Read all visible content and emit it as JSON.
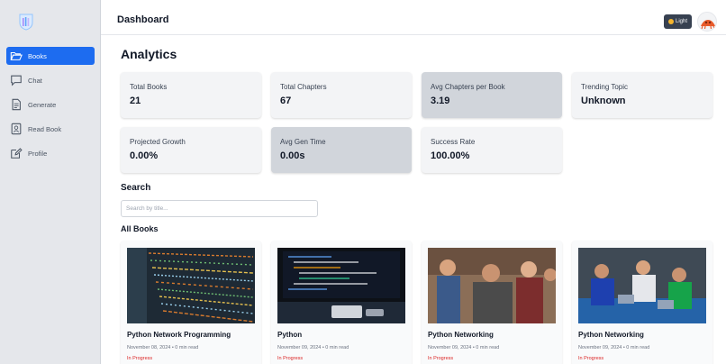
{
  "sidebar": {
    "items": [
      {
        "label": "Books",
        "icon": "folder-open-icon",
        "active": true
      },
      {
        "label": "Chat",
        "icon": "chat-icon",
        "active": false
      },
      {
        "label": "Generate",
        "icon": "document-icon",
        "active": false
      },
      {
        "label": "Read Book",
        "icon": "contact-book-icon",
        "active": false
      },
      {
        "label": "Profile",
        "icon": "edit-icon",
        "active": false
      }
    ]
  },
  "header": {
    "title": "Dashboard",
    "theme_label": "Light"
  },
  "analytics": {
    "title": "Analytics",
    "cards": [
      {
        "label": "Total Books",
        "value": "21"
      },
      {
        "label": "Total Chapters",
        "value": "67"
      },
      {
        "label": "Avg Chapters per Book",
        "value": "3.19"
      },
      {
        "label": "Trending Topic",
        "value": "Unknown"
      },
      {
        "label": "Projected Growth",
        "value": "0.00%"
      },
      {
        "label": "Avg Gen Time",
        "value": "0.00s"
      },
      {
        "label": "Success Rate",
        "value": "100.00%"
      }
    ]
  },
  "search": {
    "title": "Search",
    "placeholder": "Search by title..."
  },
  "books": {
    "title": "All Books",
    "items": [
      {
        "title": "Python Network Programming",
        "meta": "November 08, 2024 • 0 min read",
        "status": "In Progress"
      },
      {
        "title": "Python",
        "meta": "November 09, 2024 • 0 min read",
        "status": "In Progress"
      },
      {
        "title": "Python Networking",
        "meta": "November 09, 2024 • 0 min read",
        "status": "In Progress"
      },
      {
        "title": "Python Networking",
        "meta": "November 09, 2024 • 0 min read",
        "status": "In Progress"
      }
    ]
  },
  "colors": {
    "accent": "#1d6cf0",
    "status_in_progress": "#dc2626",
    "sidebar_bg": "#e5e7eb"
  }
}
